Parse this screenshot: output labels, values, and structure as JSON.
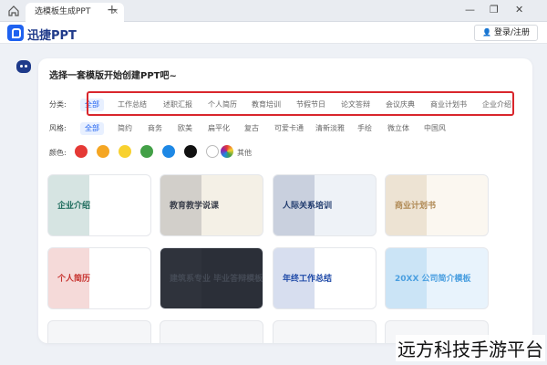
{
  "tabbar": {
    "tab_title": "选模板生成PPT",
    "close_glyph": "×",
    "new_tab_glyph": "+",
    "window_controls": [
      "—",
      "❐",
      "✕"
    ]
  },
  "app": {
    "logo_text": "迅捷PPT",
    "login_label": "登录/注册",
    "user_glyph": "👤"
  },
  "main": {
    "title": "选择一套模版开始创建PPT吧~",
    "category": {
      "label": "分类:",
      "items": [
        "全部",
        "工作总结",
        "述职汇报",
        "个人简历",
        "教育培训",
        "节假节日",
        "论文答辩",
        "会议庆典",
        "商业计划书",
        "企业介绍"
      ],
      "active_index": 0
    },
    "style": {
      "label": "风格:",
      "items": [
        "全部",
        "简约",
        "商务",
        "欧美",
        "扁平化",
        "复古",
        "可爱卡通",
        "清新淡雅",
        "手绘",
        "微立体",
        "中国风"
      ],
      "active_index": 0
    },
    "color": {
      "label": "颜色:",
      "swatches": [
        "#e53935",
        "#f5a623",
        "#f8d12f",
        "#43a047",
        "#1e88e5",
        "#111111",
        "#ffffff"
      ],
      "other_label": "其他"
    }
  },
  "templates": [
    {
      "title": "企业介绍",
      "accent": "#1d6b5c",
      "bg": "#ffffff"
    },
    {
      "title": "教育教学说课",
      "accent": "#3a3f4b",
      "bg": "#f4f0e6"
    },
    {
      "title": "人际关系培训",
      "accent": "#1f3a6d",
      "bg": "#eef2f7"
    },
    {
      "title": "商业计划书",
      "accent": "#b08a55",
      "bg": "#fbf7f0"
    },
    {
      "title": "个人简历",
      "accent": "#c7332f",
      "bg": "#ffffff"
    },
    {
      "title": "建筑系专业 毕业答辩模板",
      "accent": "#444a55",
      "bg": "#2b2f38"
    },
    {
      "title": "年终工作总结",
      "accent": "#1f4aa8",
      "bg": "#ffffff"
    },
    {
      "title": "20XX 公司简介模板",
      "accent": "#4a9fe0",
      "bg": "#e8f3fc"
    }
  ],
  "watermark": "远方科技手游平台"
}
